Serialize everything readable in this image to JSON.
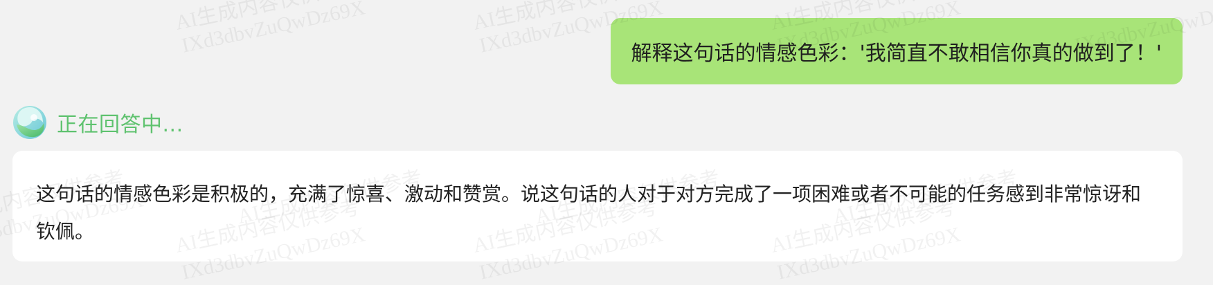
{
  "conversation": {
    "user_message": "解释这句话的情感色彩：'我简直不敢相信你真的做到了！'",
    "assistant_status": "正在回答中...",
    "assistant_answer": "这句话的情感色彩是积极的，充满了惊喜、激动和赞赏。说这句话的人对于对方完成了一项困难或者不可能的任务感到非常惊讶和钦佩。"
  },
  "watermark": {
    "line_a": "AI生成内容仅供参考",
    "line_b": "IXd3dbvZuQwDz69X"
  },
  "colors": {
    "background": "#f2f2f2",
    "user_bubble": "#a8e478",
    "status_text": "#5fc26f",
    "answer_card": "#ffffff"
  },
  "icons": {
    "assistant_avatar": "assistant-logo-icon"
  }
}
